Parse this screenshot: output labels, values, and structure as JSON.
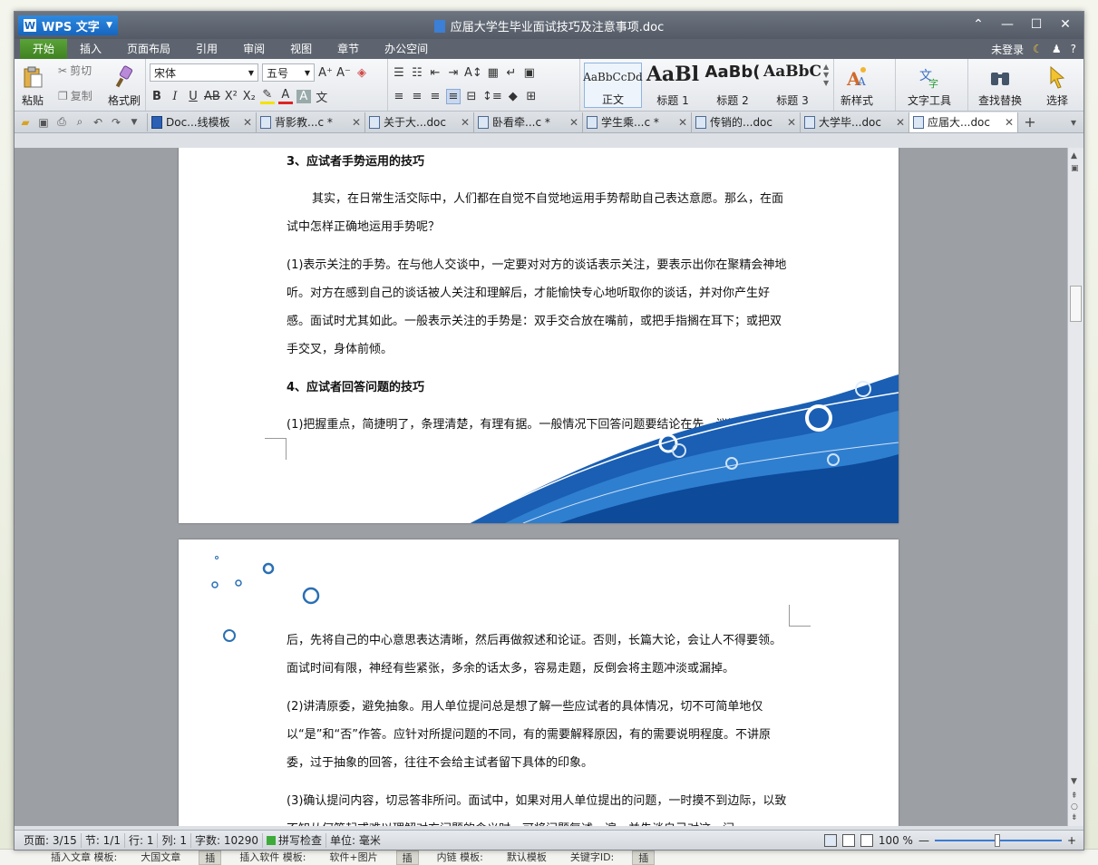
{
  "window": {
    "app_button": "WPS 文字",
    "title": "应届大学生毕业面试技巧及注意事项.doc",
    "controls": [
      "⌃",
      "—",
      "☐",
      "✕"
    ]
  },
  "menu": {
    "items": [
      "开始",
      "插入",
      "页面布局",
      "引用",
      "审阅",
      "视图",
      "章节",
      "办公空间"
    ],
    "login": "未登录",
    "help": "?"
  },
  "ribbon": {
    "paste": "粘贴",
    "cut": "剪切",
    "copy": "复制",
    "format_painter": "格式刷",
    "font_name": "宋体",
    "font_size": "五号",
    "styles": [
      {
        "sample": "AaBbCcDd",
        "label": "正文"
      },
      {
        "sample": "AaBl",
        "label": "标题 1"
      },
      {
        "sample": "AaBb(",
        "label": "标题 2"
      },
      {
        "sample": "AaBbC",
        "label": "标题 3"
      }
    ],
    "new_style": "新样式",
    "text_tools": "文字工具",
    "find_replace": "查找替换",
    "select": "选择"
  },
  "tabs": [
    {
      "label": "Doc...线模板",
      "active": false
    },
    {
      "label": "背影教...c *",
      "active": false
    },
    {
      "label": "关于大...doc",
      "active": false
    },
    {
      "label": "卧看牵...c *",
      "active": false
    },
    {
      "label": "学生乘...c *",
      "active": false
    },
    {
      "label": "传销的...doc",
      "active": false
    },
    {
      "label": "大学毕...doc",
      "active": false
    },
    {
      "label": "应届大...doc",
      "active": true
    }
  ],
  "document": {
    "page1": {
      "heading3": "3、应试者手势运用的技巧",
      "para1": "其实，在日常生活交际中，人们都在自觉不自觉地运用手势帮助自己表达意愿。那么，在面试中怎样正确地运用手势呢？",
      "para2": "(1)表示关注的手势。在与他人交谈中，一定要对对方的谈话表示关注，要表示出你在聚精会神地听。对方在感到自己的谈话被人关注和理解后，才能愉快专心地听取你的谈话，并对你产生好感。面试时尤其如此。一般表示关注的手势是：双手交合放在嘴前，或把手指搁在耳下；或把双手交叉，身体前倾。",
      "heading4": "4、应试者回答问题的技巧",
      "para3": "(1)把握重点，简捷明了，条理清楚，有理有据。一般情况下回答问题要结论在先，议论在"
    },
    "page2": {
      "para1": "后，先将自己的中心意思表达清晰，然后再做叙述和论证。否则，长篇大论，会让人不得要领。面试时间有限，神经有些紧张，多余的话太多，容易走题，反倒会将主题冲淡或漏掉。",
      "para2": "(2)讲清原委，避免抽象。用人单位提问总是想了解一些应试者的具体情况，切不可简单地仅以“是”和“否”作答。应针对所提问题的不同，有的需要解释原因，有的需要说明程度。不讲原委，过于抽象的回答，往往不会给主试者留下具体的印象。",
      "para3": "(3)确认提问内容，切忌答非所问。面试中，如果对用人单位提出的问题，一时摸不到边际，以致不知从何答起或难以理解对方问题的含义时，可将问题复述一遍，并先谈自己对这一问"
    }
  },
  "status": {
    "page": "页面: 3/15",
    "section": "节: 1/1",
    "row": "行: 1",
    "col": "列: 1",
    "words": "字数: 10290",
    "spell": "拼写检查",
    "unit": "单位: 毫米",
    "zoom": "100 %"
  },
  "background_taskbar": {
    "items": [
      "插入文章 模板:",
      "大国文章",
      "插",
      "插入软件 模板:",
      "软件+图片",
      "插",
      "内链 模板:",
      "默认模板",
      "关键字ID:",
      "插"
    ]
  },
  "colors": {
    "accent_green": "#4d8f2a",
    "wps_blue": "#1565c0",
    "wave_blue": "#1a5fb4"
  }
}
